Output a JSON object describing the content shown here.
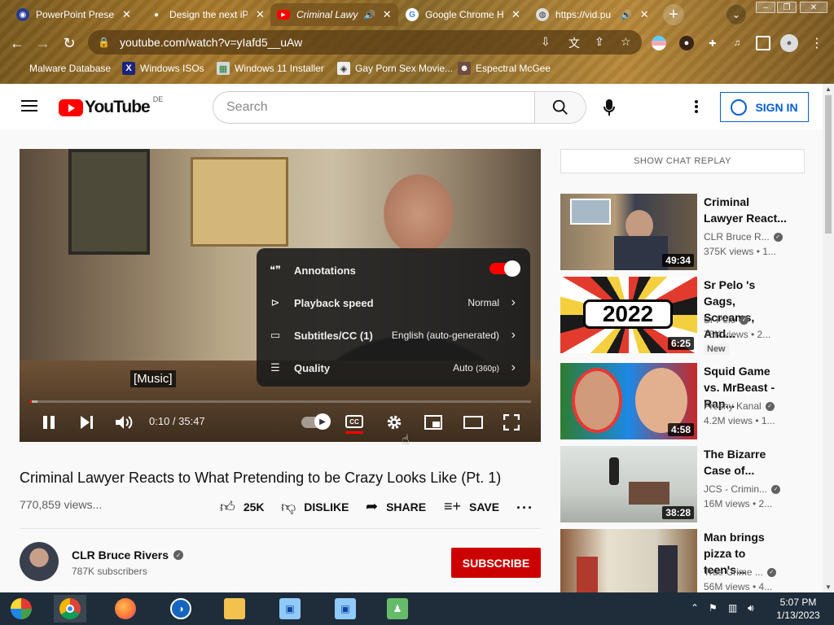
{
  "browser": {
    "tabs": [
      {
        "title": "PowerPoint Presen",
        "icon": "powerpoint-icon"
      },
      {
        "title": "Design the next iP",
        "icon": "apple-icon"
      },
      {
        "title": "Criminal Lawy",
        "icon": "youtube-icon",
        "audio": true
      },
      {
        "title": "Google Chrome He",
        "icon": "google-icon"
      },
      {
        "title": "https://vid.pu",
        "icon": "globe-icon",
        "audio": true
      }
    ],
    "url": "youtube.com/watch?v=yIafd5__uAw",
    "bookmarks": [
      {
        "label": "Malware Database"
      },
      {
        "label": "Windows ISOs"
      },
      {
        "label": "Windows 11 Installer"
      },
      {
        "label": "Gay Porn Sex Movie..."
      },
      {
        "label": "Espectral McGee"
      }
    ]
  },
  "header": {
    "logo_text": "YouTube",
    "country_code": "DE",
    "search_placeholder": "Search",
    "signin_label": "SIGN IN"
  },
  "player": {
    "caption": "[Music]",
    "time": "0:10 / 35:47",
    "progress_fraction": 0.005,
    "settings": [
      {
        "label": "Annotations",
        "value": "",
        "toggle": true
      },
      {
        "label": "Playback speed",
        "value": "Normal"
      },
      {
        "label": "Subtitles/CC (1)",
        "value": "English (auto-generated)"
      },
      {
        "label": "Quality",
        "value": "Auto",
        "value_suffix": "(360p)"
      }
    ]
  },
  "video": {
    "title": "Criminal Lawyer Reacts to What Pretending to be Crazy Looks Like (Pt. 1)",
    "views": "770,859 views...",
    "likes": "25K",
    "dislike_label": "DISLIKE",
    "share_label": "SHARE",
    "save_label": "SAVE"
  },
  "channel": {
    "name": "CLR Bruce Rivers",
    "subscribers": "787K subscribers",
    "subscribe_label": "SUBSCRIBE"
  },
  "sidebar": {
    "chat_replay_label": "SHOW CHAT REPLAY",
    "recommendations": [
      {
        "title": "Criminal Lawyer React...",
        "channel": "CLR Bruce R...",
        "meta": "375K views  • 1...",
        "duration": "49:34",
        "badge": ""
      },
      {
        "title": "Sr Pelo 's Gags, Screams, And...",
        "channel": "Sr Pelo",
        "meta": "75K views  • 2...",
        "duration": "6:25",
        "badge": "New"
      },
      {
        "title": "Squid Game vs. MrBeast - Rap...",
        "channel": "Freshy Kanal",
        "meta": "4.2M views  • 1...",
        "duration": "4:58",
        "badge": ""
      },
      {
        "title": "The Bizarre Case of...",
        "channel": "JCS - Crimin...",
        "meta": "16M views  • 2...",
        "duration": "38:28",
        "badge": ""
      },
      {
        "title": "Man brings pizza to teen's...",
        "channel": "True Crime ...",
        "meta": "56M views  • 4...",
        "duration": "",
        "badge": ""
      }
    ]
  },
  "taskbar": {
    "time": "5:07 PM",
    "date": "1/13/2023"
  }
}
